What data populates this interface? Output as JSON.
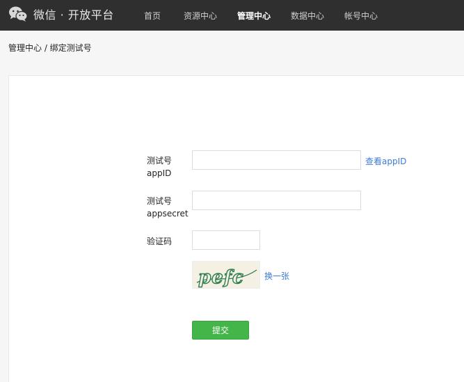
{
  "header": {
    "logo_text": "微信 · 开放平台",
    "nav": [
      {
        "label": "首页",
        "active": false
      },
      {
        "label": "资源中心",
        "active": false
      },
      {
        "label": "管理中心",
        "active": true
      },
      {
        "label": "数据中心",
        "active": false
      },
      {
        "label": "帐号中心",
        "active": false
      }
    ]
  },
  "breadcrumb": "管理中心 / 绑定测试号",
  "form": {
    "appid_label_line1": "测试号",
    "appid_label_line2": "appID",
    "appid_value": "",
    "view_appid_link": "查看appID",
    "secret_label_line1": "测试号",
    "secret_label_line2": "appsecret",
    "secret_value": "",
    "captcha_label": "验证码",
    "captcha_value": "",
    "captcha_text": "pefc",
    "refresh_captcha_link": "换一张",
    "submit_label": "提交"
  },
  "colors": {
    "topbar": "#2f2f2f",
    "link": "#3c7bd6",
    "submit": "#44b549",
    "captcha_ink": "#2e7d4f"
  }
}
